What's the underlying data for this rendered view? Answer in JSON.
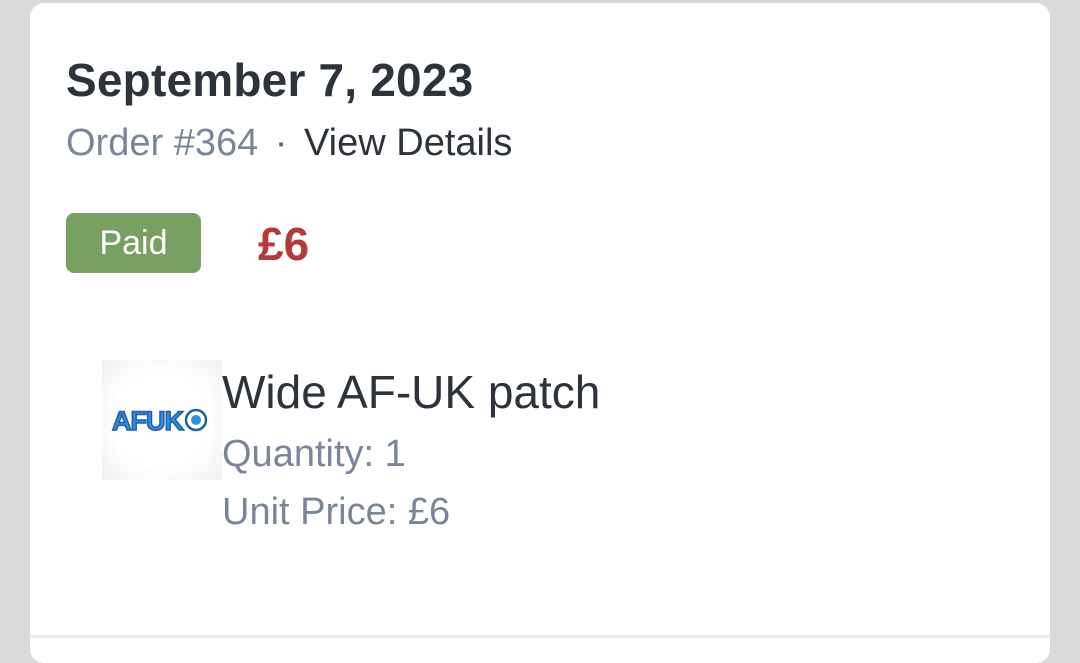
{
  "order": {
    "date": "September 7, 2023",
    "number": "Order #364",
    "separator": "·",
    "details_link": "View Details",
    "status": "Paid",
    "total": "£6"
  },
  "item": {
    "name": "Wide AF-UK patch",
    "quantity": "Quantity: 1",
    "unit_price": "Unit Price: £6",
    "thumbnail_logo_text": "AFUK"
  },
  "colors": {
    "status_paid": "#78a062",
    "total_price": "#b33a3a",
    "muted_text": "#7a8599",
    "logo_blue": "#2f8ee0"
  }
}
